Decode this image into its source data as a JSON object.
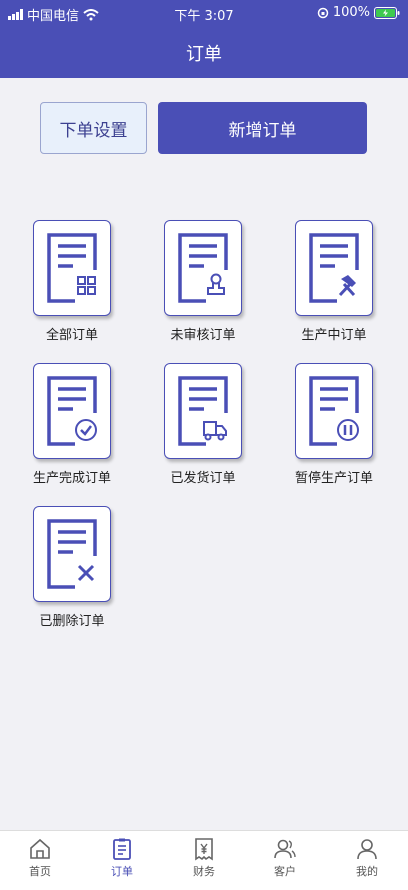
{
  "status_bar": {
    "carrier": "中国电信",
    "time": "下午 3:07",
    "battery": "100%"
  },
  "header": {
    "title": "订单"
  },
  "actions": {
    "settings_label": "下单设置",
    "new_order_label": "新增订单"
  },
  "order_types": [
    {
      "label": "全部订单",
      "icon": "grid-icon"
    },
    {
      "label": "未审核订单",
      "icon": "stamp-icon"
    },
    {
      "label": "生产中订单",
      "icon": "hammer-icon"
    },
    {
      "label": "生产完成订单",
      "icon": "check-icon"
    },
    {
      "label": "已发货订单",
      "icon": "truck-icon"
    },
    {
      "label": "暂停生产订单",
      "icon": "pause-icon"
    },
    {
      "label": "已删除订单",
      "icon": "x-icon"
    }
  ],
  "tabs": [
    {
      "label": "首页",
      "icon": "home-icon"
    },
    {
      "label": "订单",
      "icon": "clipboard-icon"
    },
    {
      "label": "财务",
      "icon": "receipt-icon"
    },
    {
      "label": "客户",
      "icon": "users-icon"
    },
    {
      "label": "我的",
      "icon": "user-icon"
    }
  ],
  "active_tab": 1,
  "colors": {
    "brand": "#4a4fb6",
    "background": "#f1f1f5",
    "settings_bg": "#e8f0fb"
  }
}
